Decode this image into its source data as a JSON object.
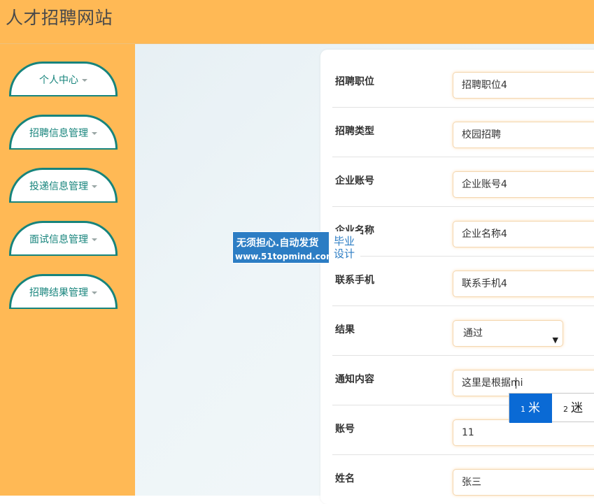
{
  "header": {
    "title": "人才招聘网站"
  },
  "sidebar": {
    "items": [
      {
        "label": "个人中心",
        "icon": "caret-down-icon"
      },
      {
        "label": "招聘信息管理",
        "icon": "caret-down-icon"
      },
      {
        "label": "投递信息管理",
        "icon": "caret-down-icon"
      },
      {
        "label": "面试信息管理",
        "icon": "caret-down-icon"
      },
      {
        "label": "招聘结果管理",
        "icon": "caret-down-icon"
      }
    ]
  },
  "form": {
    "fields": [
      {
        "label": "招聘职位",
        "value": "招聘职位4"
      },
      {
        "label": "招聘类型",
        "value": "校园招聘"
      },
      {
        "label": "企业账号",
        "value": "企业账号4"
      },
      {
        "label": "企业名称",
        "value": "企业名称4"
      },
      {
        "label": "联系手机",
        "value": "联系手机4"
      },
      {
        "label": "结果",
        "value": "通过"
      },
      {
        "label": "通知内容",
        "value": "这里是根据mi"
      },
      {
        "label": "账号",
        "value": "11"
      },
      {
        "label": "姓名",
        "value": "张三"
      }
    ]
  },
  "ime": {
    "candidates": [
      {
        "index": "1",
        "text": "米"
      },
      {
        "index": "2",
        "text": "迷"
      }
    ]
  },
  "watermark": {
    "line1": "无须担心.自动发货",
    "line2": "www.51topmind.com",
    "side": "毕业设计"
  },
  "colors": {
    "header_bg": "#ffb955",
    "accent": "#17847c",
    "ime_highlight": "#0a6ad5"
  }
}
